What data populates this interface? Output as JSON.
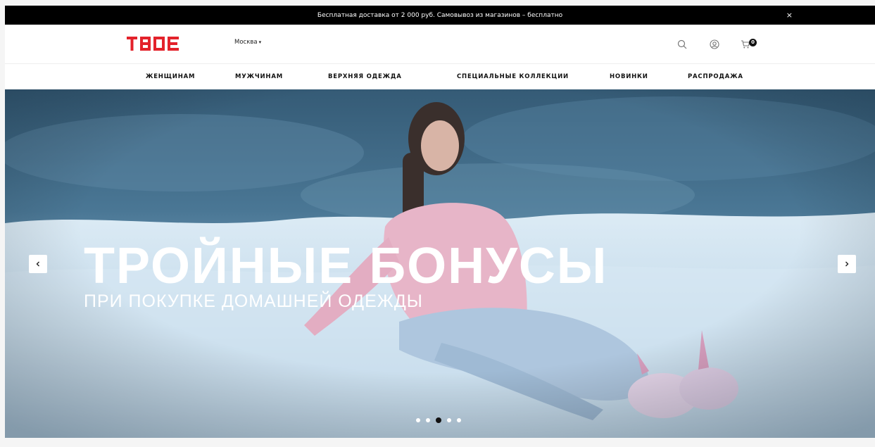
{
  "promo": {
    "text": "Бесплатная доставка от 2 000 руб. Самовывоз из магазинов – бесплатно",
    "close_glyph": "×"
  },
  "header": {
    "logo_text": "ТВОЕ",
    "logo_color": "#e3222b",
    "city": "Москва",
    "city_caret": "▾",
    "icons": [
      "search-icon",
      "account-icon",
      "cart-icon"
    ],
    "cart_count": "0"
  },
  "nav": {
    "items": [
      "ЖЕНЩИНАМ",
      "МУЖЧИНАМ",
      "ВЕРХНЯЯ ОДЕЖДА",
      "СПЕЦИАЛЬНЫЕ КОЛЛЕКЦИИ",
      "НОВИНКИ",
      "РАСПРОДАЖА"
    ]
  },
  "hero": {
    "title": "ТРОЙНЫЕ БОНУСЫ",
    "subtitle": "ПРИ ПОКУПКЕ ДОМАШНЕЙ ОДЕЖДЫ",
    "prev_icon": "chevron-left-icon",
    "next_icon": "chevron-right-icon",
    "slide_count": 5,
    "active_slide": 3
  },
  "colors": {
    "promo_bg": "#000000",
    "sky": "#3f6a89",
    "snow": "#cfe3f1",
    "sweater": "#e7b5c8",
    "pants": "#aec6de"
  }
}
